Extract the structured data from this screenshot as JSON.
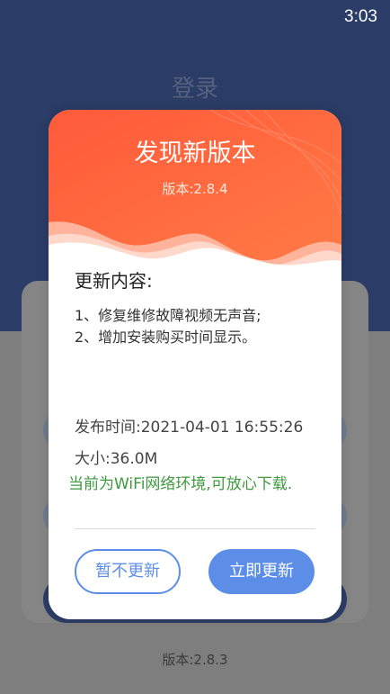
{
  "status_bar": {
    "time": "3:03"
  },
  "background": {
    "title": "登录",
    "version": "版本:2.8.3"
  },
  "dialog": {
    "title": "发现新版本",
    "version": "版本:2.8.4",
    "content_heading": "更新内容:",
    "changes": [
      "1、修复维修故障视频无声音;",
      "2、增加安装购买时间显示。"
    ],
    "release_time": "发布时间:2021-04-01 16:55:26",
    "size": "大小:36.0M",
    "wifi_note": "当前为WiFi网络环境,可放心下载.",
    "buttons": {
      "later": "暂不更新",
      "update": "立即更新"
    },
    "colors": {
      "header_orange": "#ff6a3d",
      "primary_blue": "#5c8ee8",
      "note_green": "#3f9a3f"
    }
  }
}
